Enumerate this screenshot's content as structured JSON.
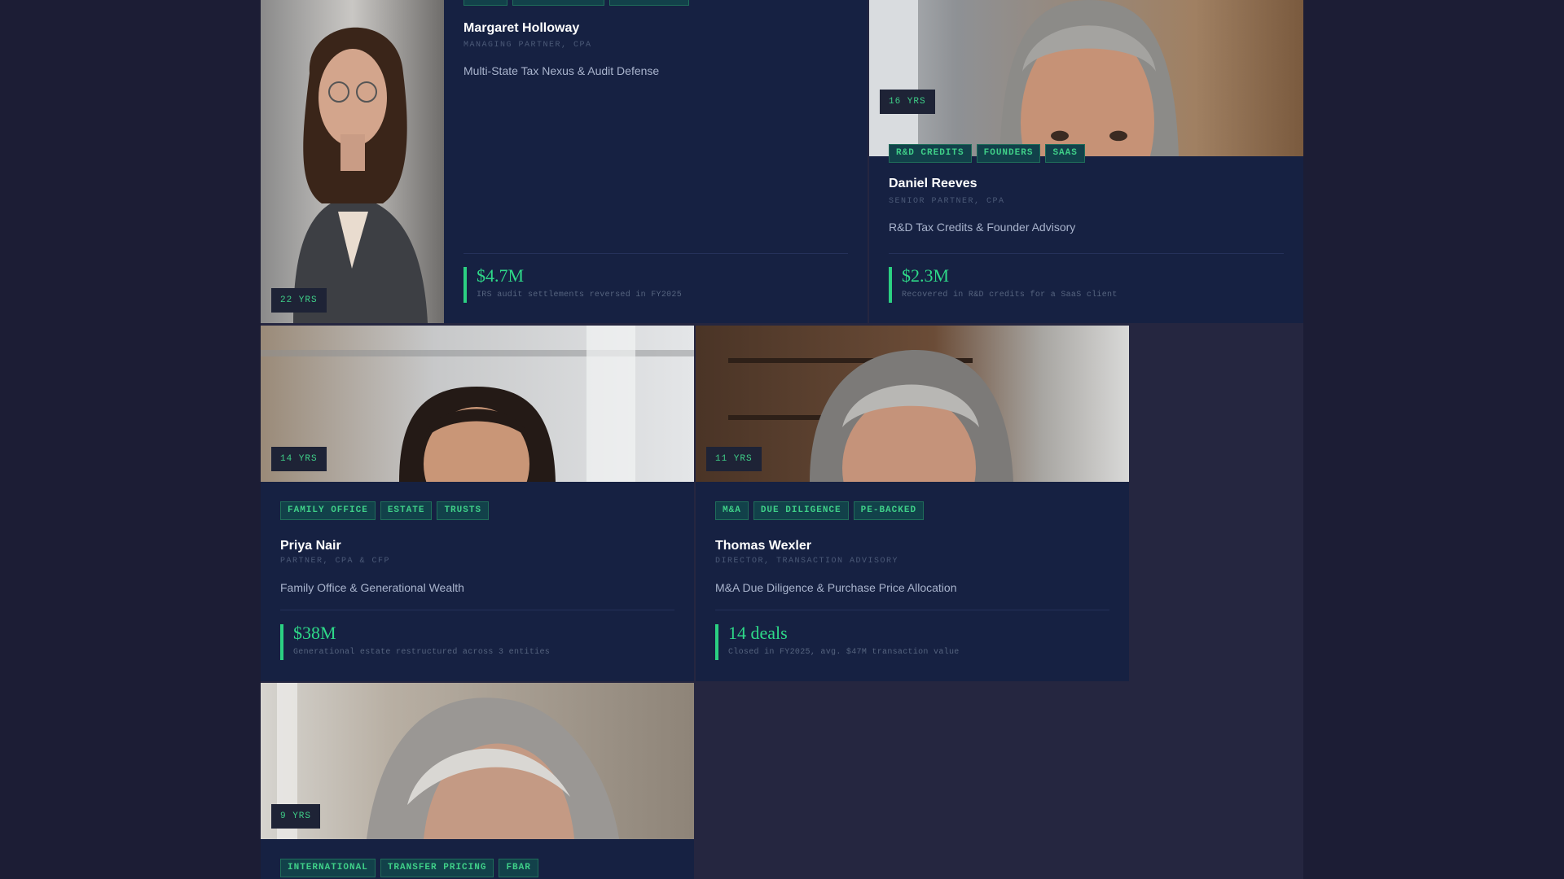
{
  "featured": {
    "name": "Margaret Holloway",
    "role": "MANAGING PARTNER, CPA",
    "specialty": "Multi-State Tax Nexus & Audit Defense",
    "years": "22 YRS",
    "metric_value": "$4.7M",
    "metric_label": "IRS audit settlements reversed in FY2025",
    "tags": [
      "",
      "",
      ""
    ]
  },
  "cards": [
    {
      "name": "Daniel Reeves",
      "role": "SENIOR PARTNER, CPA",
      "specialty": "R&D Tax Credits & Founder Advisory",
      "years": "16 YRS",
      "metric_value": "$2.3M",
      "metric_label": "Recovered in R&D credits for a SaaS client",
      "tags": [
        "R&D CREDITS",
        "FOUNDERS",
        "SAAS"
      ]
    },
    {
      "name": "Priya Nair",
      "role": "PARTNER, CPA & CFP",
      "specialty": "Family Office & Generational Wealth",
      "years": "14 YRS",
      "metric_value": "$38M",
      "metric_label": "Generational estate restructured across 3 entities",
      "tags": [
        "FAMILY OFFICE",
        "ESTATE",
        "TRUSTS"
      ]
    },
    {
      "name": "Thomas Wexler",
      "role": "DIRECTOR, TRANSACTION ADVISORY",
      "specialty": "M&A Due Diligence & Purchase Price Allocation",
      "years": "11 YRS",
      "metric_value": "14 deals",
      "metric_label": "Closed in FY2025, avg. $47M transaction value",
      "tags": [
        "M&A",
        "DUE DILIGENCE",
        "PE-BACKED"
      ]
    },
    {
      "years": "9 YRS",
      "tags": [
        "INTERNATIONAL",
        "TRANSFER PRICING",
        "FBAR"
      ]
    }
  ],
  "colors": {
    "accent": "#2ed888",
    "card_bg": "#162142",
    "page_bg": "#1c1d35"
  }
}
